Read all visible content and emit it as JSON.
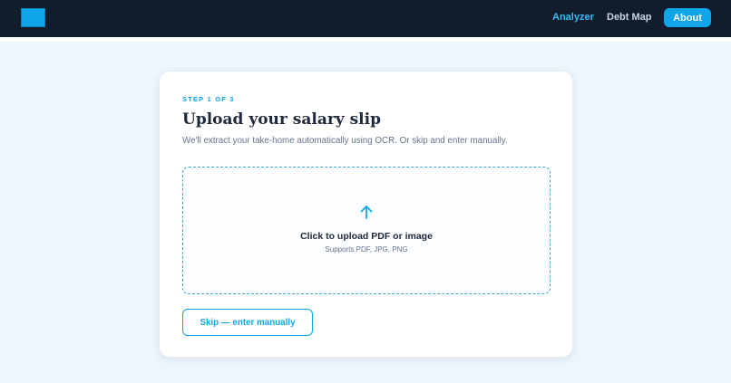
{
  "nav": {
    "links": [
      {
        "label": "Analyzer",
        "active": true
      },
      {
        "label": "Debt Map",
        "active": false
      }
    ],
    "about_label": "About"
  },
  "card": {
    "step_label": "STEP 1 OF 3",
    "title": "Upload your salary slip",
    "subtitle": "We'll extract your take-home automatically using OCR. Or skip and enter manually.",
    "dropzone": {
      "icon": "upload-arrow-icon",
      "title": "Click to upload PDF or image",
      "subtitle": "Supports PDF, JPG, PNG"
    },
    "skip_label": "Skip — enter manually"
  },
  "colors": {
    "navbar_bg": "#111c2d",
    "accent": "#0ea5e9",
    "page_bg": "#eef5fc"
  }
}
